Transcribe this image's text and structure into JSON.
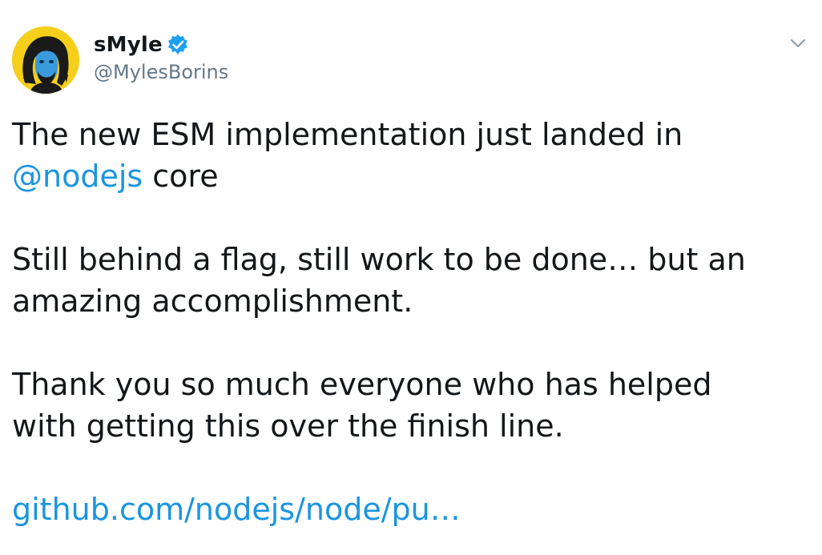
{
  "author": {
    "display_name": "sMyle",
    "handle": "@MylesBorins",
    "verified": true,
    "avatar_icon": "avatar-portrait-icon"
  },
  "tweet": {
    "line1": "The new ESM implementation just landed in",
    "mention": "@nodejs",
    "line2_after_mention": " core",
    "line3": "Still behind a flag, still work to be done… but an",
    "line4": "amazing accomplishment.",
    "line5": "Thank you so much everyone who has helped",
    "line6": "with getting this over the finish line.",
    "link_text": "github.com/nodejs/node/pu…"
  },
  "icons": {
    "verified": "verified-badge-icon",
    "more": "chevron-down-icon"
  },
  "colors": {
    "link": "#1b95e0",
    "text": "#14171a",
    "secondary": "#657786",
    "verified": "#1da1f2",
    "avatar_bg": "#f5cf1a"
  }
}
